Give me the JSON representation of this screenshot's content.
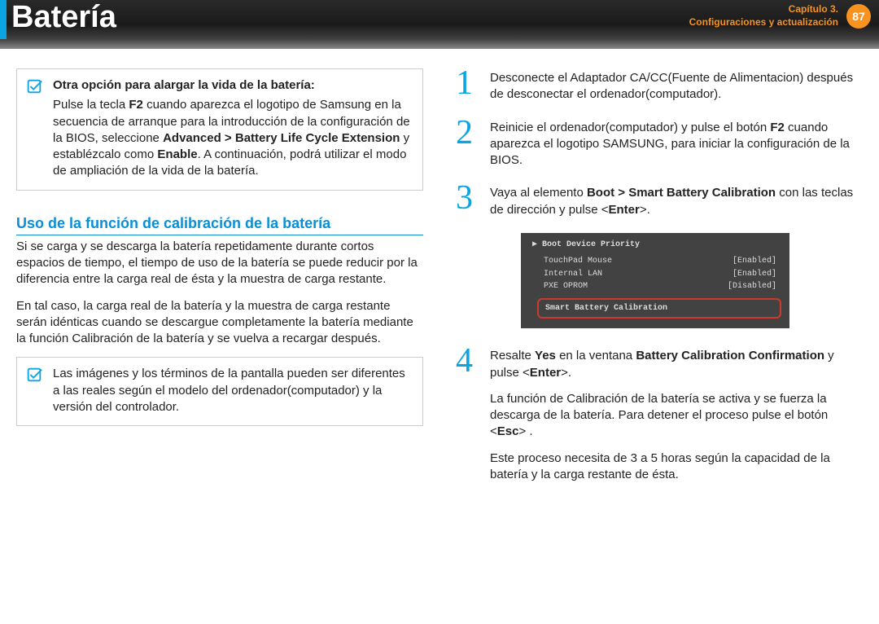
{
  "header": {
    "title": "Batería",
    "chapter_line1": "Capítulo 3.",
    "chapter_line2": "Configuraciones y actualización",
    "page_number": "87"
  },
  "left": {
    "note1": {
      "title": "Otra opción para alargar la vida de la batería:",
      "p1_pre": "Pulse la tecla ",
      "p1_f2": "F2",
      "p1_mid": " cuando aparezca el logotipo de Samsung en la secuencia de arranque para la introducción de la configuración de la BIOS, seleccione ",
      "p1_adv": "Advanced > Battery Life Cycle Extension",
      "p1_after_adv": " y establézcalo como ",
      "p1_enable": "Enable",
      "p1_tail": ". A continuación, podrá utilizar el modo de ampliación de la vida de la batería."
    },
    "section_heading": "Uso de la función de calibración de la batería",
    "p1": "Si se carga y se descarga la batería repetidamente durante cortos espacios de tiempo, el tiempo de uso de la batería se puede reducir por la diferencia entre la carga real de ésta y la muestra de carga restante.",
    "p2": "En tal caso, la carga real de la batería y la muestra de carga restante serán idénticas cuando se descargue completamente la batería mediante la función Calibración de la batería y se vuelva a recargar después.",
    "note2": "Las imágenes y los términos de la pantalla pueden ser diferentes a las reales según el modelo del ordenador(computador) y la versión del controlador."
  },
  "right": {
    "step1": "Desconecte el Adaptador CA/CC(Fuente de Alimentacion) después de desconectar el ordenador(computador).",
    "step2_pre": "Reinicie el ordenador(computador) y pulse el botón ",
    "step2_f2": "F2",
    "step2_tail": " cuando aparezca el logotipo SAMSUNG, para iniciar la configuración de la BIOS.",
    "step3_pre": "Vaya al elemento ",
    "step3_path": "Boot > Smart Battery Calibration",
    "step3_mid": " con las teclas de dirección y pulse <",
    "step3_enter": "Enter",
    "step3_tail": ">.",
    "bios": {
      "header": "▶ Boot Device Priority",
      "r1_label": "TouchPad Mouse",
      "r1_val": "[Enabled]",
      "r2_label": "Internal LAN",
      "r2_val": "[Enabled]",
      "r3_label": "PXE OPROM",
      "r3_val": "[Disabled]",
      "highlight": "Smart Battery Calibration"
    },
    "step4_p1_pre": "Resalte ",
    "step4_yes": "Yes",
    "step4_p1_mid": " en la ventana ",
    "step4_conf": "Battery Calibration Confirmation",
    "step4_p1_tail1": " y pulse <",
    "step4_enter": "Enter",
    "step4_p1_tail2": ">.",
    "step4_p2_pre": "La función de Calibración de la batería se activa y se fuerza la descarga de la batería. Para detener el proceso pulse el botón <",
    "step4_esc": "Esc",
    "step4_p2_tail": "> .",
    "step4_p3": "Este proceso necesita de 3 a 5 horas según la capacidad de la batería y la carga restante de ésta."
  }
}
